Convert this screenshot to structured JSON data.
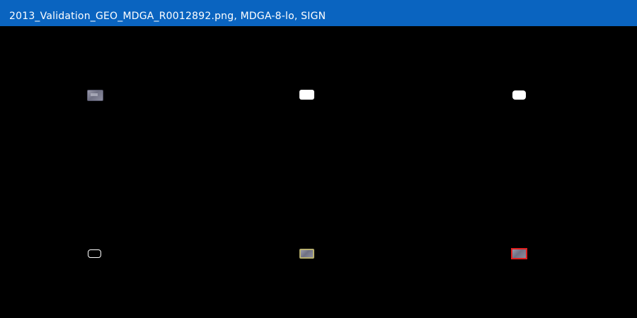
{
  "window": {
    "title": "2013_Validation_GEO_MDGA_R0012892.png, MDGA-8-lo, SIGN"
  },
  "panels": [
    {
      "kind": "image-crop"
    },
    {
      "kind": "mask-filled"
    },
    {
      "kind": "mask-filled-smoothed"
    },
    {
      "kind": "mask-outline"
    },
    {
      "kind": "overlay-outline"
    },
    {
      "kind": "overlay-red-outline"
    }
  ],
  "colors": {
    "titlebar": "#0a64c0",
    "title_text": "#ffffff",
    "background": "#000000",
    "mask": "#ffffff",
    "highlight": "#e02020"
  }
}
